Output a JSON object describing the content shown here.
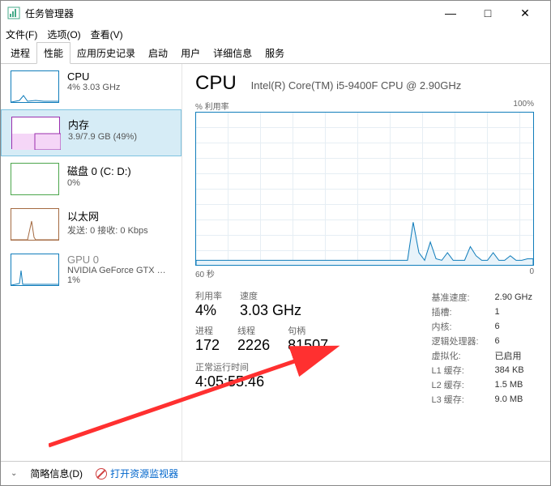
{
  "window": {
    "title": "任务管理器"
  },
  "controls": {
    "min": "—",
    "max": "□",
    "close": "✕"
  },
  "menu": [
    "文件(F)",
    "选项(O)",
    "查看(V)"
  ],
  "tabs": [
    "进程",
    "性能",
    "应用历史记录",
    "启动",
    "用户",
    "详细信息",
    "服务"
  ],
  "sidebar": [
    {
      "title": "CPU",
      "sub": "4% 3.03 GHz"
    },
    {
      "title": "内存",
      "sub": "3.9/7.9 GB (49%)"
    },
    {
      "title": "磁盘 0 (C: D:)",
      "sub": "0%"
    },
    {
      "title": "以太网",
      "sub": "发送: 0 接收: 0 Kbps"
    },
    {
      "title": "GPU 0",
      "sub": "NVIDIA GeForce GTX …",
      "sub2": "1%"
    }
  ],
  "main": {
    "title": "CPU",
    "model": "Intel(R) Core(TM) i5-9400F CPU @ 2.90GHz",
    "util_label": "% 利用率",
    "util_max": "100%",
    "time_label": "60 秒",
    "time_zero": "0"
  },
  "stats": {
    "util": {
      "label": "利用率",
      "value": "4%"
    },
    "speed": {
      "label": "速度",
      "value": "3.03 GHz"
    },
    "proc": {
      "label": "进程",
      "value": "172"
    },
    "threads": {
      "label": "线程",
      "value": "2226"
    },
    "handles": {
      "label": "句柄",
      "value": "81507"
    },
    "uptime_label": "正常运行时间",
    "uptime": "4:05:55:46"
  },
  "info": {
    "base": {
      "k": "基准速度:",
      "v": "2.90 GHz"
    },
    "sockets": {
      "k": "插槽:",
      "v": "1"
    },
    "cores": {
      "k": "内核:",
      "v": "6"
    },
    "lp": {
      "k": "逻辑处理器:",
      "v": "6"
    },
    "virt": {
      "k": "虚拟化:",
      "v": "已启用"
    },
    "l1": {
      "k": "L1 缓存:",
      "v": "384 KB"
    },
    "l2": {
      "k": "L2 缓存:",
      "v": "1.5 MB"
    },
    "l3": {
      "k": "L3 缓存:",
      "v": "9.0 MB"
    }
  },
  "status": {
    "brief": "简略信息(D)",
    "monitor": "打开资源监视器"
  },
  "chart_data": {
    "type": "line",
    "title": "% 利用率",
    "xlabel": "60 秒",
    "ylabel": "",
    "ylim": [
      0,
      100
    ],
    "xlim": [
      60,
      0
    ],
    "series": [
      {
        "name": "CPU",
        "values": [
          3,
          3,
          3,
          3,
          3,
          3,
          3,
          3,
          3,
          3,
          3,
          3,
          3,
          3,
          3,
          3,
          3,
          3,
          3,
          3,
          3,
          3,
          3,
          3,
          3,
          3,
          3,
          3,
          3,
          3,
          3,
          3,
          3,
          3,
          3,
          3,
          3,
          3,
          28,
          8,
          3,
          15,
          4,
          3,
          8,
          3,
          3,
          3,
          12,
          6,
          3,
          3,
          8,
          3,
          3,
          6,
          3,
          3,
          4,
          4
        ]
      }
    ]
  }
}
